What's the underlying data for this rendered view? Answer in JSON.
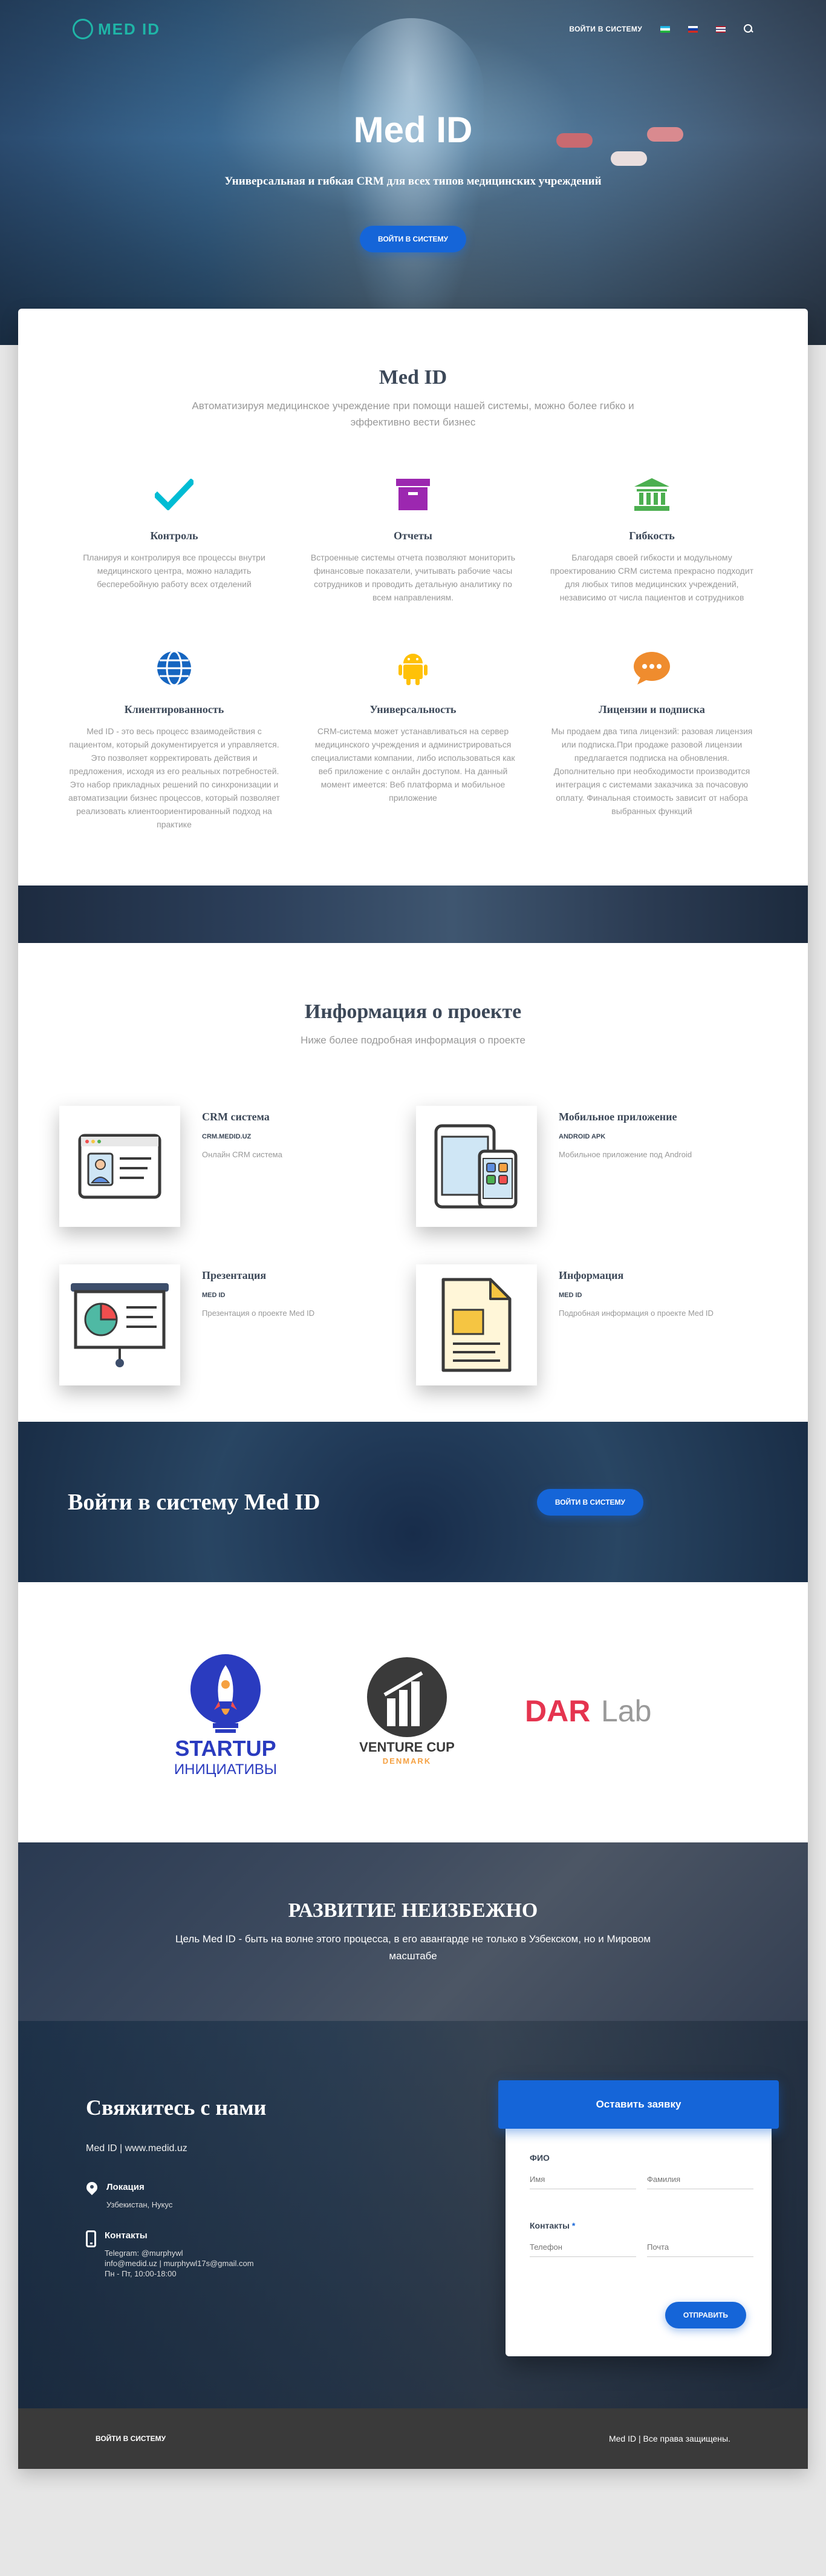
{
  "nav": {
    "logo_text": "MED ID",
    "login": "Войти в систему",
    "langs": [
      "uz",
      "ru",
      "en"
    ]
  },
  "hero": {
    "title": "Med ID",
    "subtitle": "Универсальная и гибкая CRM для всех типов медицинских учреждений",
    "button": "Войти в систему"
  },
  "intro": {
    "title": "Med ID",
    "lead": "Автоматизируя медицинское учреждение при помощи нашей системы, можно более гибко и эффективно вести бизнес"
  },
  "features": [
    {
      "icon": "checkmark-icon",
      "color": "#00bcd4",
      "title": "Контроль",
      "text": "Планируя и контролируя все процессы внутри медицинского центра, можно наладить бесперебойную работу всех отделений"
    },
    {
      "icon": "archive-icon",
      "color": "#9c27b0",
      "title": "Отчеты",
      "text": "Встроенные системы отчета позволяют мониторить финансовые показатели, учитывать рабочие часы сотрудников и проводить детальную аналитику по всем направлениям."
    },
    {
      "icon": "bank-icon",
      "color": "#4caf50",
      "title": "Гибкость",
      "text": "Благодаря своей гибкости и модульному проектированию CRM система прекрасно подходит для любых типов медицинских учреждений, независимо от числа пациентов и сотрудников"
    },
    {
      "icon": "globe-icon",
      "color": "#1565c0",
      "title": "Клиентированность",
      "text": "Med ID - это весь процесс взаимодействия с пациентом, который документируется и управляется. Это позволяет корректировать действия и предложения, исходя из его реальных потребностей. Это набор прикладных решений по синхронизации и автоматизации бизнес процессов, который позволяет реализовать клиентоориентированный подход на практике"
    },
    {
      "icon": "android-icon",
      "color": "#ffc107",
      "title": "Универсальность",
      "text": "CRM-система может устанавливаться на сервер медицинского учреждения и администрироваться специалистами компании, либо использоваться как веб приложение с онлайн доступом. На данный момент имеется: Веб платформа и мобильное приложение"
    },
    {
      "icon": "chat-icon",
      "color": "#ef8c2e",
      "title": "Лицензии и подписка",
      "text": "Мы продаем два типа лицензий: разовая лицензия или подписка.При продаже разовой лицензии предлагается подписка на обновления. Дополнительно при необходимости производится интеграция с системами заказчика за почасовую оплату. Финальная стоимость зависит от набора выбранных функций"
    }
  ],
  "info": {
    "title": "Информация о проекте",
    "lead": "Ниже более подробная информация о проекте",
    "items": [
      {
        "icon": "crm-profile-icon",
        "title": "CRM система",
        "category": "CRM.MEDID.UZ",
        "desc": "Онлайн CRM система"
      },
      {
        "icon": "mobile-devices-icon",
        "title": "Мобильное приложение",
        "category": "ANDROID APK",
        "desc": "Мобильное приложение под Android"
      },
      {
        "icon": "presentation-icon",
        "title": "Презентация",
        "category": "MED ID",
        "desc": "Презентация о проекте Med ID"
      },
      {
        "icon": "document-icon",
        "title": "Информация",
        "category": "MED ID",
        "desc": "Подробная информация о проекте Med ID"
      }
    ]
  },
  "login_banner": {
    "title": "Войти в систему Med ID",
    "button": "Войти в систему"
  },
  "partners": {
    "startup_top": "STARTUP",
    "startup_bottom": "ИНИЦИАТИВЫ",
    "venture_top": "VENTURE CUP",
    "venture_bottom": "DENMARK",
    "dar_a": "DAR",
    "dar_b": "Lab"
  },
  "development": {
    "title": "Развитие неизбежно",
    "text": "Цель Med ID - быть на волне этого процесса, в его авангарде не только в Узбекском, но и Мировом масштабе"
  },
  "contact": {
    "title": "Свяжитесь с нами",
    "site": "Med ID | www.medid.uz",
    "location_title": "Локация",
    "location_text": "Узбекистан, Нукус",
    "contacts_title": "Контакты",
    "contacts_lines": [
      "Telegram: @murphywl",
      "info@medid.uz | murphywl17s@gmail.com",
      "Пн - Пт, 10:00-18:00"
    ]
  },
  "form": {
    "header": "Оставить заявку",
    "fio_label": "ФИО",
    "first_name_ph": "Имя",
    "last_name_ph": "Фамилия",
    "contacts_label": "Контакты",
    "phone_ph": "Телефон",
    "email_ph": "Почта",
    "submit": "Отправить"
  },
  "footer": {
    "link": "Войти в систему",
    "copyright": "Med ID | Все права защищены."
  },
  "colors": {
    "primary": "#1565d8",
    "teal": "#1fb5a7"
  }
}
